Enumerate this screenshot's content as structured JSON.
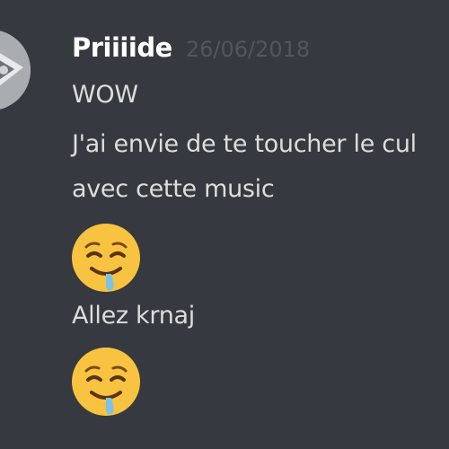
{
  "message": {
    "author": "Priiiide",
    "timestamp": "26/06/2018",
    "lines": [
      "WOW",
      "J'ai envie de te toucher le cul",
      "avec cette music",
      "Allez krnaj"
    ],
    "emojis": [
      "drooling-face-icon",
      "drooling-face-icon"
    ]
  },
  "colors": {
    "background": "#36393f",
    "username": "#ffffff",
    "timestamp": "#53565d",
    "text": "#dcddde",
    "emoji_face": "#f7c340",
    "drool": "#7cc3e8"
  }
}
